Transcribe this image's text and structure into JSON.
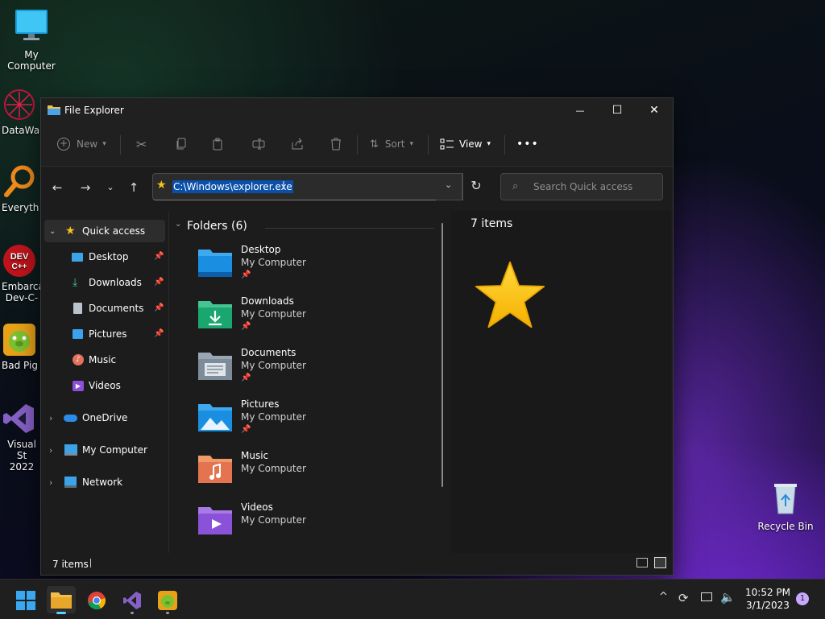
{
  "desktop": {
    "icons": [
      {
        "label": "My Computer",
        "icon": "monitor-icon"
      },
      {
        "label": "DataWag",
        "icon": "datawag-icon"
      },
      {
        "label": "Everyth",
        "icon": "everything-search-icon"
      },
      {
        "label": "Embarca\nDev-C-",
        "icon": "devcpp-icon"
      },
      {
        "label": "Bad Pig",
        "icon": "bad-piggies-icon"
      },
      {
        "label": "Visual St\n2022",
        "icon": "visual-studio-icon"
      },
      {
        "label": "Recycle Bin",
        "icon": "recycle-bin-icon"
      }
    ]
  },
  "window": {
    "title": "File Explorer",
    "controls": {
      "minimize": "—",
      "maximize": "☐",
      "close": "✕"
    }
  },
  "toolbar": {
    "new_label": "New",
    "sort_label": "Sort",
    "view_label": "View",
    "more_label": "•••"
  },
  "address": {
    "path": "C:\\Windows\\explorer.exe",
    "search_placeholder": "Search Quick access"
  },
  "nav_pane": {
    "quick_access": "Quick access",
    "items": [
      {
        "label": "Desktop",
        "pinned": true
      },
      {
        "label": "Downloads",
        "pinned": true
      },
      {
        "label": "Documents",
        "pinned": true
      },
      {
        "label": "Pictures",
        "pinned": true
      },
      {
        "label": "Music",
        "pinned": false
      },
      {
        "label": "Videos",
        "pinned": false
      }
    ],
    "roots": [
      "OneDrive",
      "My Computer",
      "Network"
    ]
  },
  "content": {
    "group_header": "Folders (6)",
    "folders": [
      {
        "name": "Desktop",
        "location": "My Computer",
        "pinned": true
      },
      {
        "name": "Downloads",
        "location": "My Computer",
        "pinned": true
      },
      {
        "name": "Documents",
        "location": "My Computer",
        "pinned": true
      },
      {
        "name": "Pictures",
        "location": "My Computer",
        "pinned": true
      },
      {
        "name": "Music",
        "location": "My Computer",
        "pinned": false
      },
      {
        "name": "Videos",
        "location": "My Computer",
        "pinned": false
      }
    ]
  },
  "preview": {
    "count_text": "7 items"
  },
  "status": {
    "count_text": "7 items"
  },
  "taskbar": {
    "time": "10:52 PM",
    "date": "3/1/2023",
    "notification_count": "1"
  },
  "colors": {
    "selection": "#0a4fa8",
    "star": "#f5c518",
    "window_bg": "#1c1c1c"
  }
}
